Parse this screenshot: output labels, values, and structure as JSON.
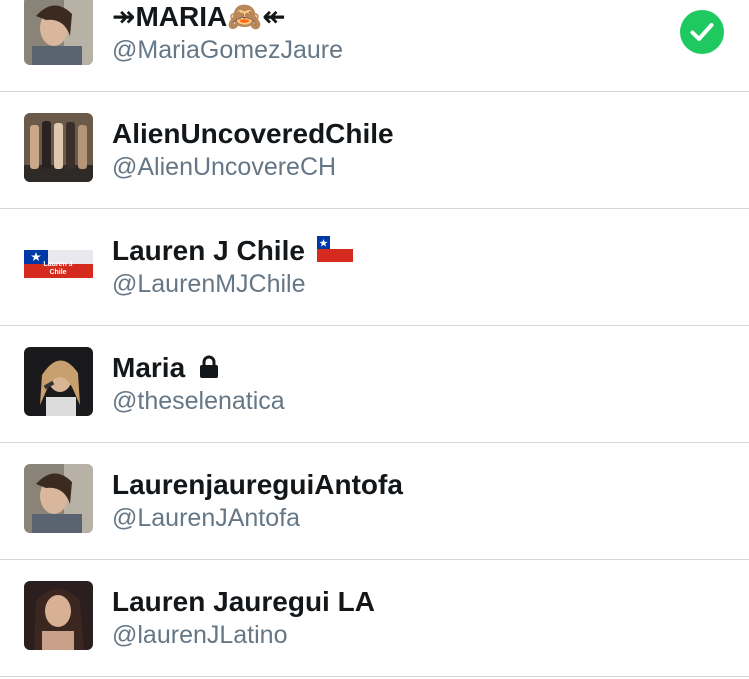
{
  "accounts": [
    {
      "name": "↠MARIA🙈↞",
      "handle": "@MariaGomezJaure",
      "selected": true
    },
    {
      "name": "AlienUncoveredChile",
      "handle": "@AlienUncovereCH",
      "selected": false
    },
    {
      "name": "Lauren J Chile",
      "handle": "@LaurenMJChile",
      "selected": false,
      "flag": "🇨🇱"
    },
    {
      "name": "Maria",
      "handle": "@theselenatica",
      "selected": false,
      "locked": true
    },
    {
      "name": "LaurenjaureguiAntofa",
      "handle": "@LaurenJAntofa",
      "selected": false
    },
    {
      "name": "Lauren Jauregui LA",
      "handle": "@laurenJLatino",
      "selected": false
    }
  ],
  "avatar_texts": {
    "lauren_chile": [
      "Lauren J",
      "Chile"
    ]
  },
  "colors": {
    "check_green": "#1ec95f",
    "name_text": "#14171a",
    "handle_text": "#657786",
    "divider": "#d8d8d8",
    "flag_red": "#d52b1e",
    "flag_blue": "#0039a6"
  },
  "icons": {
    "selected_check": "check-circle-icon",
    "protected": "lock-icon"
  }
}
